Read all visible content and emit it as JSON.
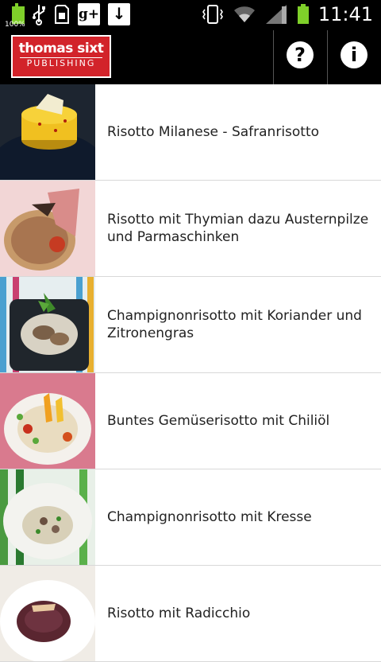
{
  "status_bar": {
    "battery_small_label": "100%",
    "gplus_label": "g+",
    "download_label": "↓",
    "time": "11:41",
    "icons": [
      "battery-icon",
      "usb-icon",
      "sd-card-icon",
      "google-plus-icon",
      "download-icon",
      "vibrate-icon",
      "wifi-icon",
      "signal-icon",
      "battery-full-icon"
    ]
  },
  "action_bar": {
    "logo_line1": "thomas sixt",
    "logo_line2": "PUBLISHING",
    "help_label": "?",
    "info_label": "i",
    "brand_color": "#d2232a"
  },
  "recipes": [
    {
      "title": "Risotto Milanese - Safranrisotto"
    },
    {
      "title": "Risotto mit Thymian dazu Austernpilze und Parmaschinken"
    },
    {
      "title": "Champignonrisotto mit Koriander und Zitronengras"
    },
    {
      "title": "Buntes Gemüserisotto mit Chiliöl"
    },
    {
      "title": "Champignonrisotto mit Kresse"
    },
    {
      "title": "Risotto mit Radicchio"
    }
  ]
}
